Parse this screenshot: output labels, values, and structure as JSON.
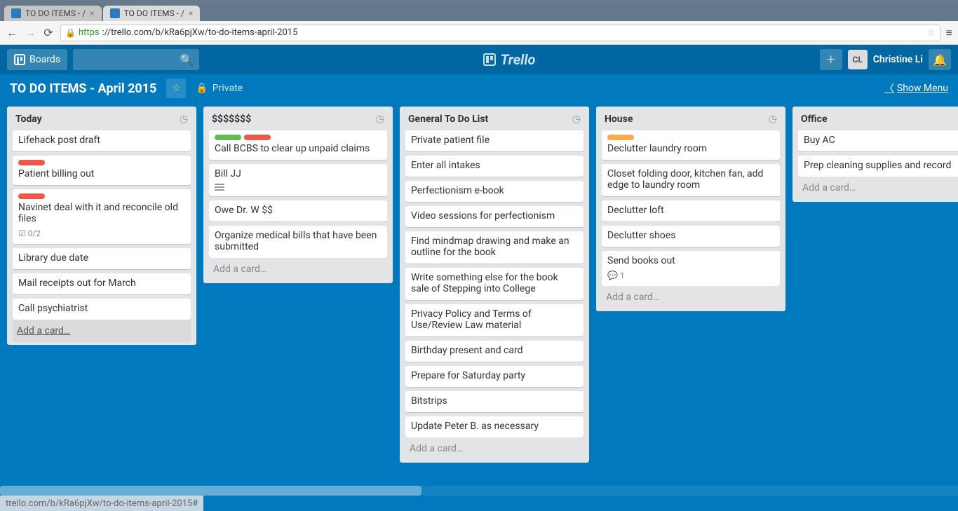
{
  "browser": {
    "tabs": [
      {
        "title": "TO DO ITEMS - /"
      },
      {
        "title": "TO DO ITEMS - /"
      }
    ],
    "url_https": "https",
    "url_rest": "://trello.com/b/kRa6pjXw/to-do-items-april-2015",
    "status_text": "trello.com/b/kRa6pjXw/to-do-items-april-2015#"
  },
  "topbar": {
    "boards_label": "Boards",
    "logo_text": "Trello",
    "user_initials": "CL",
    "user_name": "Christine Li"
  },
  "boardbar": {
    "title": "TO DO ITEMS - April 2015",
    "privacy": "Private",
    "show_menu": "Show Menu"
  },
  "add_card_label": "Add a card…",
  "lists": [
    {
      "title": "Today",
      "add_highlight": true,
      "cards": [
        {
          "text": "Lifehack post draft"
        },
        {
          "labels": [
            "red"
          ],
          "text": "Patient billing out"
        },
        {
          "labels": [
            "red"
          ],
          "text": "Navinet deal with it and reconcile old files",
          "checklist": "0/2"
        },
        {
          "text": "Library due date"
        },
        {
          "text": "Mail receipts out for March"
        },
        {
          "text": "Call psychiatrist"
        }
      ]
    },
    {
      "title": "$$$$$$$",
      "cards": [
        {
          "labels": [
            "green",
            "red"
          ],
          "text": "Call BCBS to clear up unpaid claims"
        },
        {
          "text": "Bill JJ",
          "desc": true
        },
        {
          "text": "Owe Dr. W $$"
        },
        {
          "text": "Organize medical bills that have been submitted"
        }
      ]
    },
    {
      "title": "General To Do List",
      "scroll": true,
      "cards": [
        {
          "text": "Private patient file"
        },
        {
          "text": "Enter all intakes"
        },
        {
          "text": "Perfectionism e-book"
        },
        {
          "text": "Video sessions for perfectionism"
        },
        {
          "text": "Find mindmap drawing and make an outline for the book"
        },
        {
          "text": "Write something else for the book sale of Stepping into College"
        },
        {
          "text": "Privacy Policy and Terms of Use/Review Law material"
        },
        {
          "text": "Birthday present and card"
        },
        {
          "text": "Prepare for Saturday party"
        },
        {
          "text": "Bitstrips"
        },
        {
          "text": "Update Peter B. as necessary"
        }
      ]
    },
    {
      "title": "House",
      "cards": [
        {
          "labels": [
            "orange"
          ],
          "text": "Declutter laundry room"
        },
        {
          "text": "Closet folding door, kitchen fan, add edge to laundry room"
        },
        {
          "text": "Declutter loft"
        },
        {
          "text": "Declutter shoes"
        },
        {
          "text": "Send books out",
          "comments": "1"
        }
      ]
    },
    {
      "title": "Office",
      "cards": [
        {
          "text": "Buy AC"
        },
        {
          "text": "Prep cleaning supplies and record"
        }
      ]
    }
  ]
}
